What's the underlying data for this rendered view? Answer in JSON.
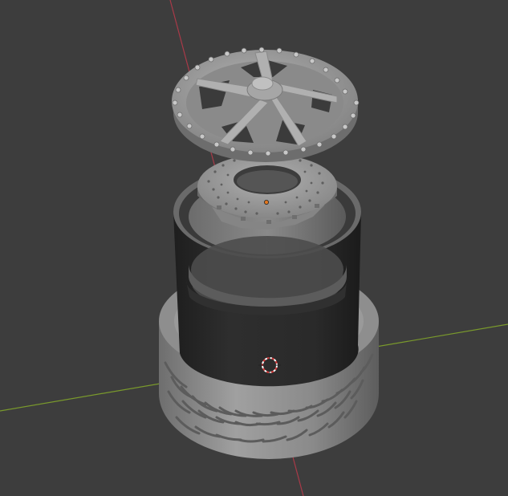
{
  "viewport": {
    "mode": "3d-viewport",
    "background_color": "#3d3d3d",
    "grid": true,
    "axes": {
      "x_axis_color": "#7a9a2c",
      "y_axis_color": "#a93a48"
    },
    "origin_marker_color": "#e3781f",
    "cursor_color_primary": "#d43a3a",
    "cursor_color_secondary": "#ffffff"
  },
  "scene": {
    "objects": [
      {
        "name": "wheel-face",
        "icon": "rim-face-icon",
        "color": "#9a9a9a",
        "spokes": 5,
        "bolts": 24
      },
      {
        "name": "brake-disc",
        "icon": "brake-disc-icon",
        "color": "#969696",
        "perforated": true
      },
      {
        "name": "rim-barrel",
        "icon": "rim-barrel-icon",
        "color": "#2c2c2c"
      },
      {
        "name": "tire",
        "icon": "tire-icon",
        "color": "#8c8c8c",
        "tread": "directional"
      }
    ]
  }
}
